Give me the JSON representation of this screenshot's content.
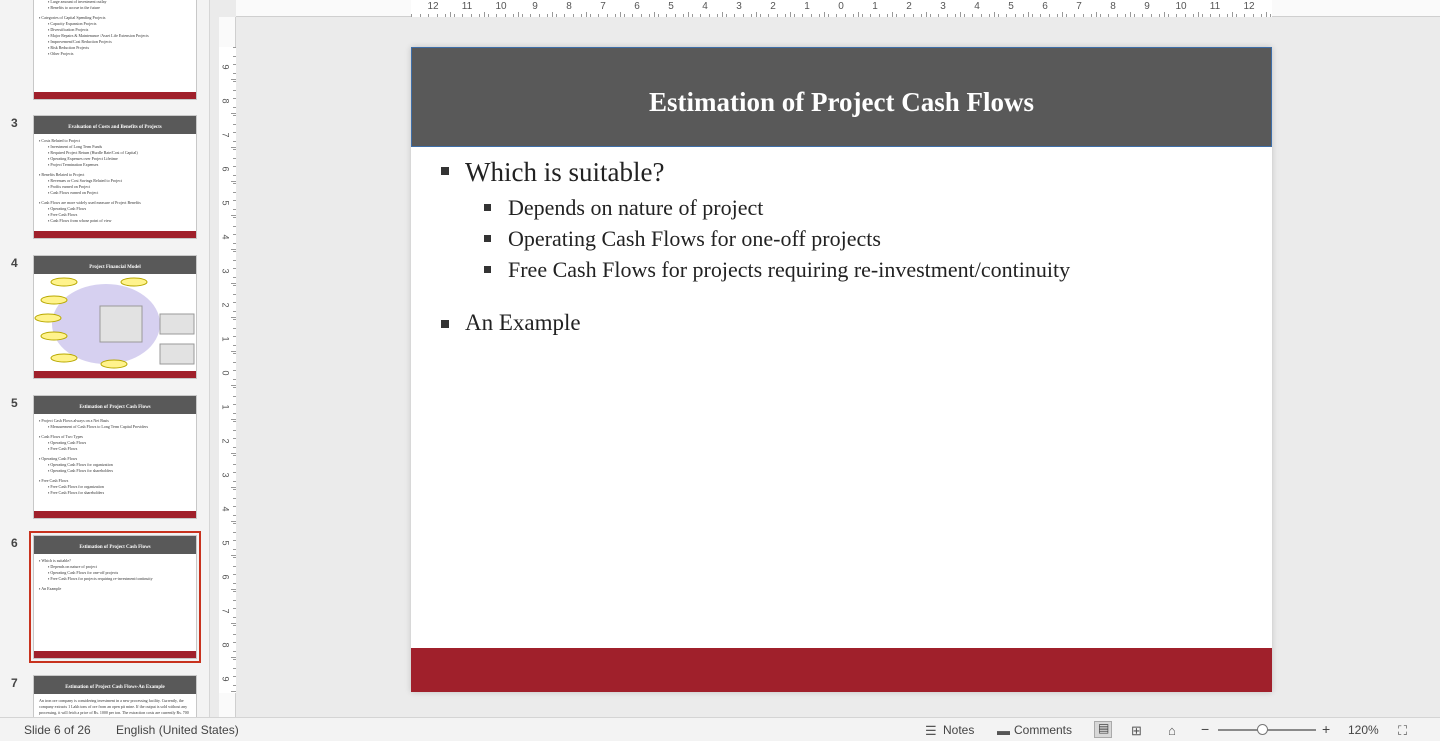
{
  "thumbnails": [
    {
      "number": "",
      "title": "",
      "lines": [
        {
          "level": 1,
          "text": "What is unique about Capital Spending Projects?"
        },
        {
          "level": 2,
          "text": "Large amount of investment outlay"
        },
        {
          "level": 2,
          "text": "Benefits to accrue in the future"
        },
        {
          "level": 0,
          "text": ""
        },
        {
          "level": 1,
          "text": "Categories of Capital Spending Projects"
        },
        {
          "level": 2,
          "text": "Capacity Expansion Projects"
        },
        {
          "level": 2,
          "text": "Diversification Projects"
        },
        {
          "level": 2,
          "text": "Major Repairs & Maintenance /Asset Life Extension Projects"
        },
        {
          "level": 2,
          "text": "Improvement/Cost Reduction Projects"
        },
        {
          "level": 2,
          "text": "Risk Reduction Projects"
        },
        {
          "level": 2,
          "text": "Other Projects"
        }
      ]
    },
    {
      "number": "3",
      "title": "Evaluation of Costs and Benefits of Projects",
      "lines": [
        {
          "level": 1,
          "text": "Costs Related to Project"
        },
        {
          "level": 2,
          "text": "Investment of Long Term Funds"
        },
        {
          "level": 2,
          "text": "Required Project Return (Hurdle Rate/Cost of Capital)"
        },
        {
          "level": 2,
          "text": "Operating Expenses over Project Lifetime"
        },
        {
          "level": 2,
          "text": "Project Termination Expenses"
        },
        {
          "level": 0,
          "text": ""
        },
        {
          "level": 1,
          "text": "Benefits Related to Project"
        },
        {
          "level": 2,
          "text": "Revenues or Cost Savings Related to Project"
        },
        {
          "level": 2,
          "text": "Profits earned on Project"
        },
        {
          "level": 2,
          "text": "Cash Flows earned on Project"
        },
        {
          "level": 0,
          "text": ""
        },
        {
          "level": 1,
          "text": "Cash Flows are more widely used measure of Project Benefits"
        },
        {
          "level": 2,
          "text": "Operating Cash Flows"
        },
        {
          "level": 2,
          "text": "Free Cash Flows"
        },
        {
          "level": 2,
          "text": "Cash Flows from whose point of view"
        }
      ]
    },
    {
      "number": "4",
      "title": "Project Financial Model",
      "lines": []
    },
    {
      "number": "5",
      "title": "Estimation of Project Cash Flows",
      "lines": [
        {
          "level": 1,
          "text": "Project Cash Flows always on a Net Basis"
        },
        {
          "level": 2,
          "text": "Measurement of Cash Flows to Long Term Capital Providers"
        },
        {
          "level": 0,
          "text": ""
        },
        {
          "level": 1,
          "text": "Cash Flows of Two Types"
        },
        {
          "level": 2,
          "text": "Operating Cash Flows"
        },
        {
          "level": 2,
          "text": "Free Cash Flows"
        },
        {
          "level": 0,
          "text": ""
        },
        {
          "level": 1,
          "text": "Operating Cash Flows"
        },
        {
          "level": 2,
          "text": "Operating Cash Flows for organization"
        },
        {
          "level": 2,
          "text": "Operating Cash Flows for shareholders"
        },
        {
          "level": 0,
          "text": ""
        },
        {
          "level": 1,
          "text": "Free Cash Flows"
        },
        {
          "level": 2,
          "text": "Free Cash Flows for organization"
        },
        {
          "level": 2,
          "text": "Free Cash Flows for shareholders"
        }
      ]
    },
    {
      "number": "6",
      "title": "Estimation of Project Cash Flows",
      "lines": [
        {
          "level": 1,
          "text": "Which is suitable?"
        },
        {
          "level": 2,
          "text": "Depends on nature of project"
        },
        {
          "level": 2,
          "text": "Operating Cash Flows for one-off projects"
        },
        {
          "level": 2,
          "text": "Free Cash Flows for projects requiring re-investment/continuity"
        },
        {
          "level": 0,
          "text": ""
        },
        {
          "level": 1,
          "text": "An Example"
        }
      ]
    },
    {
      "number": "7",
      "title": "Estimation of Project Cash Flows-An Example",
      "lines": [
        {
          "level": 3,
          "text": "An iron ore company is considering investment in a new processing facility. Currently, the company extracts 1 Lakh tons of ore from an open pit mine. If the output is sold without any processing, it will fetch a price of Rs. 1000 per ton. The extraction costs are currently Rs. 700 per ton."
        }
      ]
    }
  ],
  "slide": {
    "title": "Estimation of Project Cash Flows",
    "bullets": [
      {
        "level": 1,
        "text": "Which is suitable?"
      },
      {
        "level": 2,
        "text": "Depends on nature of project"
      },
      {
        "level": 2,
        "text": "Operating Cash Flows for one-off projects"
      },
      {
        "level": 2,
        "text": "Free Cash Flows for projects requiring re-investment/continuity"
      },
      {
        "level": 1,
        "text": "An Example"
      }
    ]
  },
  "ruler": {
    "horizontal_labels": [
      "12",
      "11",
      "10",
      "9",
      "8",
      "7",
      "6",
      "5",
      "4",
      "3",
      "2",
      "1",
      "0",
      "1",
      "2",
      "3",
      "4",
      "5",
      "6",
      "7",
      "8",
      "9",
      "10",
      "11",
      "12"
    ],
    "vertical_labels": [
      "9",
      "8",
      "7",
      "6",
      "5",
      "4",
      "3",
      "2",
      "1",
      "0",
      "1",
      "2",
      "3",
      "4",
      "5",
      "6",
      "7",
      "8",
      "9"
    ]
  },
  "statusbar": {
    "slide_counter": "Slide 6 of 26",
    "language": "English (United States)",
    "notes_label": "Notes",
    "comments_label": "Comments",
    "zoom_minus": "−",
    "zoom_plus": "+",
    "zoom_level": "120%",
    "zoom_fraction": 0.45
  },
  "colors": {
    "title_bar": "#595959",
    "footer_bar": "#a0202b",
    "selected_outline": "#c8321e"
  },
  "icons": {
    "notes": "notes-icon",
    "comments": "comment-icon",
    "normal_view": "normal-view-icon",
    "sorter_view": "grid-view-icon",
    "reading_view": "reading-view-icon",
    "fit": "fit-slide-icon"
  }
}
